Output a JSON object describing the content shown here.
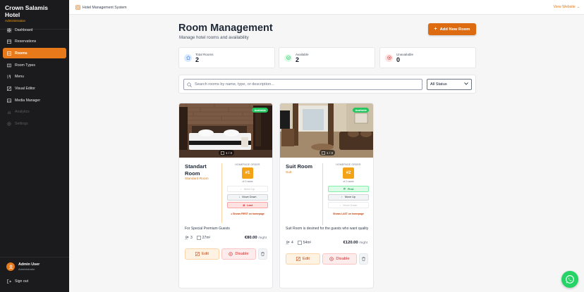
{
  "sidebar": {
    "brand_title": "Crown Salamis Hotel",
    "brand_subtitle": "Administration",
    "items": [
      {
        "label": "Dashboard",
        "icon": "grid-icon"
      },
      {
        "label": "Reservations",
        "icon": "calendar-icon"
      },
      {
        "label": "Rooms",
        "icon": "door-icon"
      },
      {
        "label": "Room Types",
        "icon": "tag-icon"
      },
      {
        "label": "Menu",
        "icon": "menu-icon"
      },
      {
        "label": "Visual Editor",
        "icon": "edit-icon"
      },
      {
        "label": "Media Manager",
        "icon": "image-icon"
      },
      {
        "label": "Analytics",
        "icon": "chart-icon"
      },
      {
        "label": "Settings",
        "icon": "gear-icon"
      }
    ],
    "active_item": "Rooms",
    "user": {
      "name": "Admin User",
      "role": "Administrator",
      "initial": "A"
    },
    "signout_label": "Sign out"
  },
  "topbar": {
    "system_name": "Hotel Management System",
    "view_website": "View Website"
  },
  "page": {
    "title": "Room Management",
    "subtitle": "Manage hotel rooms and availability",
    "add_button": "Add New Room"
  },
  "stats": [
    {
      "label": "Total Rooms",
      "value": "2",
      "color": "#3b82f6"
    },
    {
      "label": "Available",
      "value": "2",
      "color": "#22c55e"
    },
    {
      "label": "Unavailable",
      "value": "0",
      "color": "#ef4444"
    }
  ],
  "filters": {
    "search_placeholder": "Search rooms by name, type, or description...",
    "status_selected": "All Status"
  },
  "rooms": [
    {
      "name": "Standart Room",
      "type": "Standard Room",
      "badge": "Available",
      "images": "1 / 3",
      "order_title": "HOMEPAGE ORDER",
      "order_number": "#1",
      "order_of": "of 2 rooms",
      "buttons": [
        "Move Up",
        "Move Down",
        "Last"
      ],
      "order_note": "Shows FIRST on homepage",
      "description": "For Special Premium Guests",
      "guests": "3",
      "size": "27m²",
      "price": "€80.00",
      "per": "/night",
      "edit": "Edit",
      "disable": "Disable"
    },
    {
      "name": "Suit Room",
      "type": "Suit",
      "badge": "Available",
      "images": "1 / 3",
      "order_title": "HOMEPAGE ORDER",
      "order_number": "#2",
      "order_of": "of 2 rooms",
      "buttons": [
        "First",
        "Move Up",
        "Move Down"
      ],
      "order_note": "Shows LAST on homepage",
      "description": "Suit Room is desined for the guests who want quality",
      "guests": "4",
      "size": "54m²",
      "price": "€120.00",
      "per": "/night",
      "edit": "Edit",
      "disable": "Disable"
    }
  ],
  "colors": {
    "accent": "#dd6b12",
    "sidebar_bg": "#1b1b1d",
    "available": "#22c55e",
    "whatsapp": "#25d366"
  }
}
